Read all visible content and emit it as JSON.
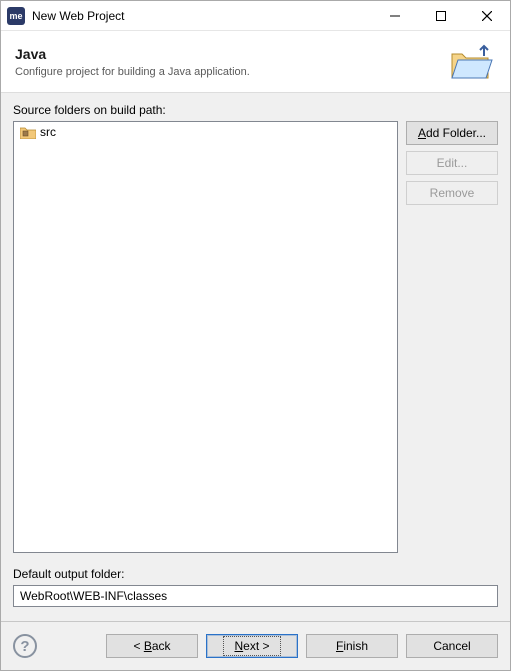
{
  "titlebar": {
    "title": "New Web Project",
    "app_icon_text": "me"
  },
  "banner": {
    "title": "Java",
    "subtitle": "Configure project for building a Java application."
  },
  "source_folders": {
    "label": "Source folders on build path:",
    "items": [
      {
        "name": "src"
      }
    ]
  },
  "side": {
    "add_prefix": "A",
    "add_rest": "dd Folder...",
    "edit": "Edit...",
    "remove": "Remove"
  },
  "output": {
    "label": "Default output folder:",
    "value": "WebRoot\\WEB-INF\\classes"
  },
  "buttons": {
    "back_lt": "< ",
    "back_u": "B",
    "back_rest": "ack",
    "next_u": "N",
    "next_rest": "ext >",
    "finish_u": "F",
    "finish_rest": "inish",
    "cancel": "Cancel"
  }
}
